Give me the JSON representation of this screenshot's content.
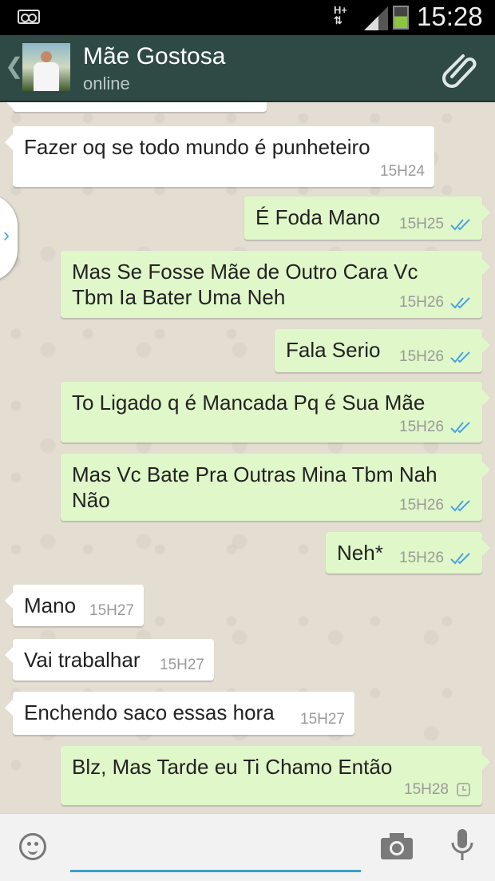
{
  "status_bar": {
    "network": "H+",
    "time": "15:28"
  },
  "header": {
    "contact_name": "Mãe Gostosa",
    "contact_status": "online"
  },
  "messages": [
    {
      "text": "Fazer oq se todo mundo é punheteiro",
      "time": "15H24",
      "direction": "in"
    },
    {
      "text": "É Foda Mano",
      "time": "15H25",
      "direction": "out",
      "status": "read"
    },
    {
      "text": "Mas Se Fosse Mãe de Outro Cara Vc Tbm Ia Bater Uma Neh",
      "time": "15H26",
      "direction": "out",
      "status": "read"
    },
    {
      "text": "Fala Serio",
      "time": "15H26",
      "direction": "out",
      "status": "read"
    },
    {
      "text": "To Ligado q é Mancada Pq é Sua Mãe",
      "time": "15H26",
      "direction": "out",
      "status": "read"
    },
    {
      "text": "Mas Vc Bate Pra Outras Mina Tbm Nah Não",
      "time": "15H26",
      "direction": "out",
      "status": "read"
    },
    {
      "text": "Neh*",
      "time": "15H26",
      "direction": "out",
      "status": "read"
    },
    {
      "text": "Mano",
      "time": "15H27",
      "direction": "in"
    },
    {
      "text": "Vai trabalhar",
      "time": "15H27",
      "direction": "in"
    },
    {
      "text": "Enchendo saco essas hora",
      "time": "15H27",
      "direction": "in"
    },
    {
      "text": "Blz, Mas Tarde eu Ti Chamo Então",
      "time": "15H28",
      "direction": "out",
      "status": "pending"
    }
  ],
  "input": {
    "value": ""
  },
  "colors": {
    "header": "#2f4a45",
    "outgoing_bubble": "#e0f7c9",
    "incoming_bubble": "#ffffff",
    "read_tick": "#4aa3df",
    "input_underline": "#3ba0c7"
  },
  "icons": [
    "voicemail-icon",
    "signal-icon",
    "battery-icon",
    "back-icon",
    "attach-icon",
    "double-tick-icon",
    "clock-icon",
    "emoji-icon",
    "camera-icon",
    "mic-icon"
  ]
}
